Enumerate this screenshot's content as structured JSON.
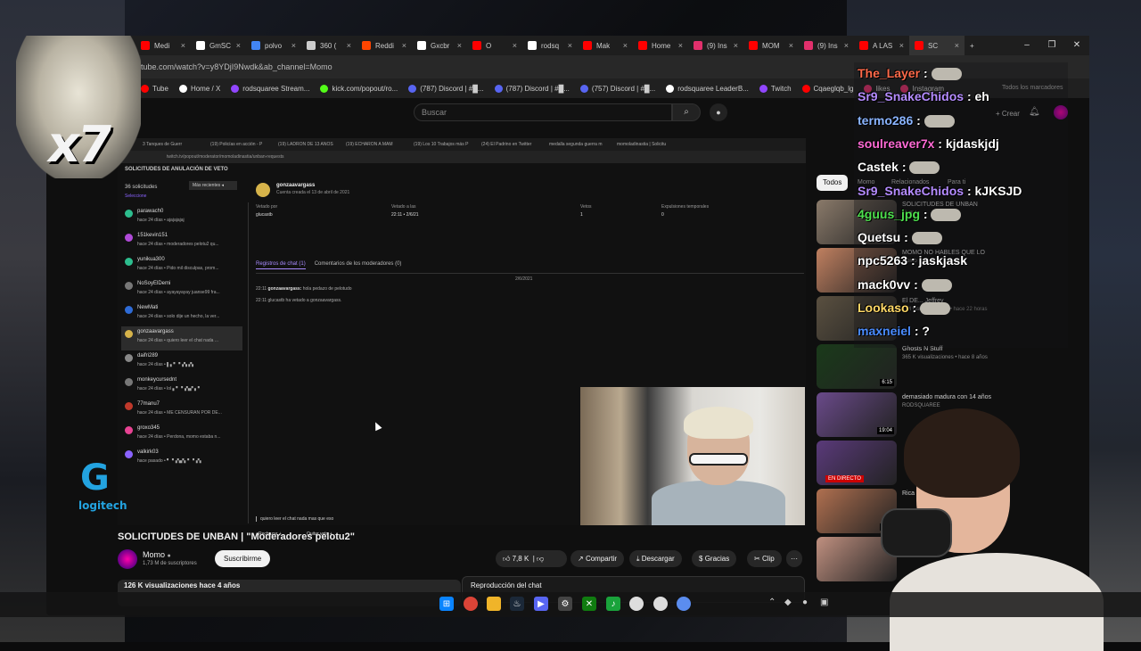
{
  "browser": {
    "tabs": [
      {
        "label": "Medi",
        "icon": "youtube-icon",
        "color": "#ff0000"
      },
      {
        "label": "GmSC",
        "icon": "x-icon",
        "color": "#ffffff"
      },
      {
        "label": "polvo",
        "icon": "google-icon",
        "color": "#4285f4"
      },
      {
        "label": "360 (",
        "icon": "generic-icon",
        "color": "#cccccc"
      },
      {
        "label": "Reddi",
        "icon": "reddit-icon",
        "color": "#ff4500"
      },
      {
        "label": "Gxcbr",
        "icon": "x-icon",
        "color": "#ffffff"
      },
      {
        "label": "O",
        "icon": "youtube-icon",
        "color": "#ff0000"
      },
      {
        "label": "rodsq",
        "icon": "x-icon",
        "color": "#ffffff"
      },
      {
        "label": "Mak",
        "icon": "youtube-icon",
        "color": "#ff0000"
      },
      {
        "label": "Home",
        "icon": "youtube-icon",
        "color": "#ff0000"
      },
      {
        "label": "(9) Ins",
        "icon": "instagram-icon",
        "color": "#e1306c"
      },
      {
        "label": "MOM",
        "icon": "youtube-icon",
        "color": "#ff0000"
      },
      {
        "label": "(9) Ins",
        "icon": "instagram-icon",
        "color": "#e1306c"
      },
      {
        "label": "A LAS",
        "icon": "youtube-icon",
        "color": "#ff0000"
      },
      {
        "label": "SC",
        "icon": "youtube-icon",
        "color": "#ff0000"
      }
    ],
    "new_tab": "+",
    "window_controls": [
      "–",
      "❐",
      "✕"
    ],
    "url": "tube.com/watch?v=y8YDjI9Nwdk&ab_channel=Momo",
    "bookmarks": [
      {
        "label": "Tube",
        "color": "#ff0000"
      },
      {
        "label": "Home / X",
        "color": "#ffffff"
      },
      {
        "label": "rodsquaree Stream...",
        "color": "#9146ff"
      },
      {
        "label": "kick.com/popout/ro...",
        "color": "#53fc18"
      },
      {
        "label": "(787) Discord | #█...",
        "color": "#5865f2"
      },
      {
        "label": "(787) Discord | #█...",
        "color": "#5865f2"
      },
      {
        "label": "(757) Discord | #█...",
        "color": "#5865f2"
      },
      {
        "label": "rodsquaree LeaderB...",
        "color": "#ffffff"
      },
      {
        "label": "Twitch",
        "color": "#9146ff"
      },
      {
        "label": "Cqaeglqb_lg",
        "color": "#ff0000"
      },
      {
        "label": "likes",
        "color": "#e1306c"
      },
      {
        "label": "Instagram",
        "color": "#e1306c"
      }
    ],
    "all_bookmarks": "Todos los marcadores"
  },
  "youtube": {
    "search_placeholder": "Buscar",
    "create": "Crear",
    "video_title": "SOLICITUDES DE UNBAN | \"Moderadores pelotu2\"",
    "channel_name": "Momo",
    "subscribers": "1,73 M de suscriptores",
    "subscribe": "Suscribirme",
    "likes": "7,8 K",
    "share": "Compartir",
    "download": "Descargar",
    "thanks": "Gracias",
    "clip": "Clip",
    "more": "···",
    "views_line": "126 K visualizaciones  hace 4 años",
    "chat_replay": "Reproducción del chat",
    "filter_all": "Todos",
    "filter_2": "Momo",
    "filter_3": "Relacionados",
    "filter_4": "Para ti"
  },
  "inner": {
    "tabs": [
      "3 Tanques de Guerr",
      "(19) Policías en acción - P",
      "(19) LADRÓN DE 13 AÑOS",
      "(19) ECHARON A MAM",
      "(19) Los 10 Trabajos más P",
      "(24) El Padrino en Twitter",
      "medalla segunda guerra m",
      "momoladinastia | Solicitu"
    ],
    "url": "twitch.tv/popout/moderator/momoladinastia/unban-requests",
    "title": "SOLICITUDES DE ANULACIÓN DE VETO",
    "count": "36 solicitudes",
    "select": "Seleccione",
    "sort": "Más recientes",
    "users": [
      {
        "name": "parawach0",
        "msg": "hace 24 días • ajajajajaj",
        "color": "#2dbd8e"
      },
      {
        "name": "151kevin151",
        "msg": "hace 24 días • moderadores pelotu2 qu...",
        "color": "#b04ad8"
      },
      {
        "name": "yunikua300",
        "msg": "hace 24 días • Pido mil disculpas, prom...",
        "color": "#2dbd8e"
      },
      {
        "name": "NoSoyElDemi",
        "msg": "hace 24 días • ayayayayay juanse99 fra...",
        "color": "#777777"
      },
      {
        "name": "NewMati",
        "msg": "hace 24 días • solo dije un hecho, la ver...",
        "color": "#2e6bd6"
      },
      {
        "name": "gonzaavargass",
        "msg": "hace 24 días • quiero leer el chat nada ...",
        "color": "#d6b34a"
      },
      {
        "name": "daifri289",
        "msg": "hace 24 días • ▌▖▘▝▗▚ ▞▖",
        "color": "#888888"
      },
      {
        "name": "monkeycursednt",
        "msg": "hace 24 días • lol ▖▘▝▗▚▞ ▖▘",
        "color": "#777777"
      },
      {
        "name": "77manu7",
        "msg": "hace 24 días • ME CENSURAN POR DE...",
        "color": "#c0392b"
      },
      {
        "name": "groxo345",
        "msg": "hace 24 días • Perdona, momo estaba n...",
        "color": "#e84393"
      },
      {
        "name": "valkirk03",
        "msg": "hace pasado • ▘▝▗▚▞▖▘▝▗▚",
        "color": "#8a63ff"
      }
    ],
    "detail": {
      "name": "gonzaavargass",
      "created": "Cuenta creada el 13 de abril de 2021",
      "banned_by_label": "Vetado por",
      "banned_by": "glucastb",
      "banned_at_label": "Vetado a las",
      "banned_at": "22:11 • 2/6/21",
      "votes_label": "Vetos",
      "votes": "1",
      "timeouts_label": "Expulsiones temporales",
      "timeouts": "0",
      "tab_chat": "Registros de chat (1)",
      "tab_mods": "Comentarios de los moderadores (0)",
      "date": "2/6/2021",
      "log1_time": "22:11",
      "log1_user": "gonzaavargass:",
      "log1_text": "hola pedazo de pelotudo",
      "log2": "22:11  glucastb ha vetado a gonzaavargass.",
      "reply": "quiero leer el chat nada mas que eso",
      "reject": "Rechazar",
      "unban": "Quitar veto"
    }
  },
  "sidebar_videos": [
    {
      "title": "SOLICITUDES DE UNBAN",
      "meta": "Momo"
    },
    {
      "title": "MOMO NO HABLES QUE LO",
      "meta": "Momo"
    },
    {
      "title": "El DE... Jeffrey",
      "meta": "1 M visualizaciones • hace 22 horas"
    },
    {
      "title": "Ghosts N Stuff",
      "meta": "365 K visualizaciones • hace 8 años",
      "length": "6:15"
    },
    {
      "title": "demasiado madura con 14 años",
      "meta": "RODSQUAREE",
      "length": "19:04"
    },
    {
      "title": "",
      "meta": "",
      "live": "EN DIRECTO"
    },
    {
      "title": "Rica",
      "meta": "",
      "length": "8:07"
    },
    {
      "title": "",
      "meta": ""
    }
  ],
  "chat": [
    {
      "user": "The_Layer",
      "text": ":",
      "color": "#ff6a4a",
      "emote": true
    },
    {
      "user": "Sr9_SnakeChidos",
      "text": ": eh",
      "color": "#b58cff",
      "emote": false
    },
    {
      "user": "termo286",
      "text": ":",
      "color": "#8ab4ff",
      "emote": true
    },
    {
      "user": "soulreaver7x",
      "text": ": kjdaskjdj",
      "color": "#ff6ad5",
      "emote": false
    },
    {
      "user": "Castek",
      "text": ":",
      "color": "#ffffff",
      "emote": true
    },
    {
      "user": "Sr9_SnakeChidos",
      "text": ": kJKSJD",
      "color": "#b58cff",
      "emote": false
    },
    {
      "user": "4guus_jpg",
      "text": ":",
      "color": "#4ee04e",
      "emote": true
    },
    {
      "user": "Quetsu",
      "text": ":",
      "color": "#ffffff",
      "emote": true
    },
    {
      "user": "npc5263",
      "text": ": jaskjask",
      "color": "#ffffff",
      "emote": false
    },
    {
      "user": "mack0vv",
      "text": ":",
      "color": "#ffffff",
      "emote": true
    },
    {
      "user": "Lookaso",
      "text": ":",
      "color": "#ffd866",
      "emote": true
    },
    {
      "user": "maxneiel",
      "text": ": ?",
      "color": "#4a8cff",
      "emote": false
    }
  ],
  "overlay": {
    "multiplier": "x7",
    "brand": "logitech",
    "brand_letter": "G"
  }
}
